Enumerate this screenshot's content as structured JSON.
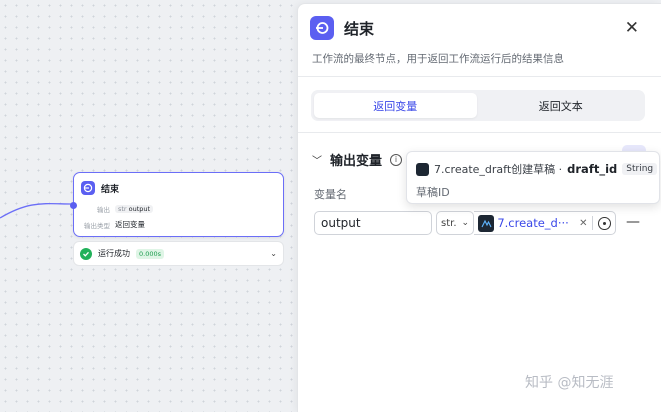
{
  "canvas": {
    "end_node": {
      "title": "结束",
      "output_label": "输出",
      "output_type": "str",
      "output_name": "output",
      "mode_label": "输出类型",
      "mode_value": "返回变量"
    },
    "run_status": {
      "label": "运行成功",
      "time": "0.000s"
    }
  },
  "panel": {
    "title": "结束",
    "description": "工作流的最终节点，用于返回工作流运行后的结果信息",
    "tabs": [
      {
        "label": "返回变量",
        "active": true
      },
      {
        "label": "返回文本",
        "active": false
      }
    ],
    "section": {
      "title": "输出变量",
      "column_label": "变量名",
      "rows": [
        {
          "name": "output",
          "type": "str.",
          "reference": "7.create_d···"
        }
      ]
    },
    "tooltip": {
      "path": "7.create_draft创建草稿 ·",
      "variable": "draft_id",
      "type": "String",
      "description": "草稿ID"
    }
  },
  "watermark": "知乎 @知无涯",
  "colors": {
    "accent": "#5b5ff1",
    "link": "#3b48e8",
    "success": "#21b15a"
  },
  "icons": [
    "end-node-icon",
    "check-icon",
    "chevron-down-icon",
    "close-icon",
    "info-icon",
    "plugin-logo-icon",
    "target-icon",
    "minus-icon"
  ]
}
